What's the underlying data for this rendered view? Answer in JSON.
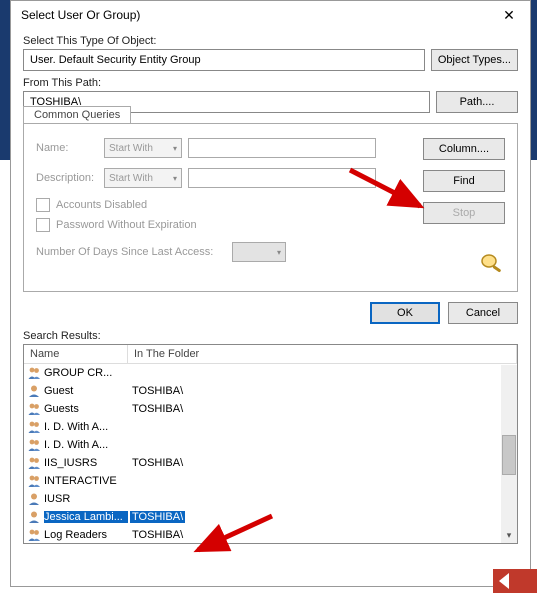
{
  "title": "Select User Or Group)",
  "section1": {
    "label": "Select This Type Of Object:",
    "value": "User. Default Security Entity Group",
    "btn": "Object Types..."
  },
  "section2": {
    "label": "From This Path:",
    "value": "TOSHIBA\\",
    "btn": "Path...."
  },
  "queries": {
    "tab": "Common Queries",
    "name_lbl": "Name:",
    "desc_lbl": "Description:",
    "dropdown": "Start With",
    "cb1": "Accounts Disabled",
    "cb2": "Password Without Expiration",
    "days_lbl": "Number Of Days Since Last Access:"
  },
  "side_btns": {
    "column": "Column....",
    "find": "Find",
    "stop": "Stop"
  },
  "ok": "OK",
  "cancel": "Cancel",
  "results_lbl": "Search Results:",
  "cols": {
    "name": "Name",
    "folder": "In The Folder"
  },
  "rows": [
    {
      "icon": "group",
      "name": "GROUP CR...",
      "folder": ""
    },
    {
      "icon": "user",
      "name": "Guest",
      "folder": "TOSHIBA\\"
    },
    {
      "icon": "group",
      "name": "Guests",
      "folder": "TOSHIBA\\"
    },
    {
      "icon": "group",
      "name": "I. D. With A...",
      "folder": ""
    },
    {
      "icon": "group",
      "name": "I. D. With A...",
      "folder": ""
    },
    {
      "icon": "group",
      "name": "IIS_IUSRS",
      "folder": "TOSHIBA\\"
    },
    {
      "icon": "group",
      "name": "INTERACTIVE",
      "folder": ""
    },
    {
      "icon": "user",
      "name": "IUSR",
      "folder": ""
    },
    {
      "icon": "user",
      "name": "Jessica Lambi...",
      "folder": "TOSHIBA\\",
      "selected": true
    },
    {
      "icon": "group",
      "name": "Log Readers",
      "folder": "TOSHIBA\\"
    }
  ]
}
